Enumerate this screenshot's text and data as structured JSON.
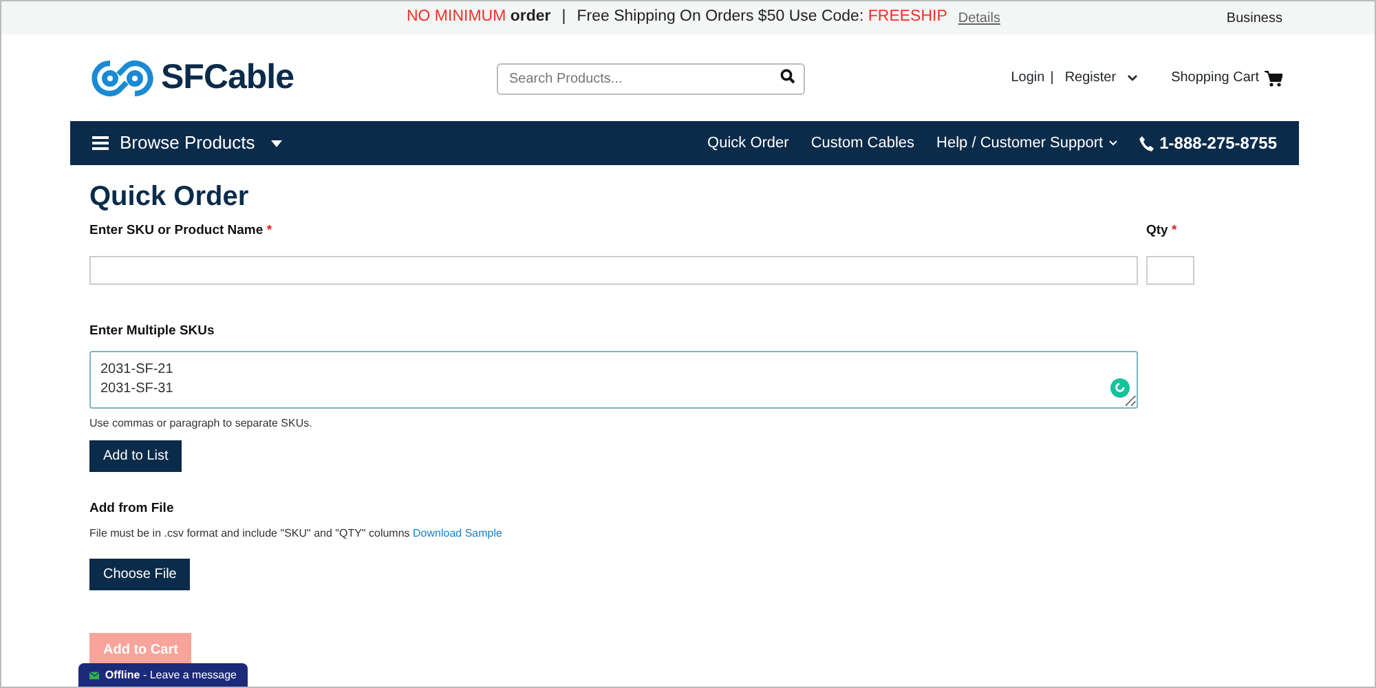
{
  "promo_bar": {
    "highlight": "NO MINIMUM",
    "after_highlight": "order",
    "separator": "|",
    "shipping": "Free Shipping On Orders $50 Use Code:",
    "code": "FREESHIP",
    "details": "Details",
    "business": "Business"
  },
  "header": {
    "logo": "SFCable",
    "search": {
      "placeholder": "Search Products..."
    },
    "login": "Login",
    "separator": "|",
    "register": "Register",
    "cart": "Shopping Cart"
  },
  "nav": {
    "browse": "Browse Products",
    "links": [
      {
        "label": "Quick Order",
        "dropdown": false
      },
      {
        "label": "Custom Cables",
        "dropdown": false
      },
      {
        "label": "Help / Customer Support",
        "dropdown": true
      }
    ],
    "phone": "1-888-275-8755"
  },
  "form": {
    "title": "Quick Order",
    "sku_label": "Enter SKU or Product Name",
    "sku_required": "*",
    "qty_label": "Qty",
    "qty_required": "*",
    "multi_label": "Enter Multiple SKUs",
    "multi_value": "2031-SF-21\n2031-SF-31",
    "multi_help": "Use commas or paragraph to separate SKUs.",
    "add_to_list": "Add to List",
    "file_heading": "Add from File",
    "file_help": "File must be in .csv format and include \"SKU\" and \"QTY\" columns",
    "file_link": "Download Sample",
    "choose_file": "Choose File",
    "add_to_cart": {
      "label": "Add to Cart",
      "disabled": true
    }
  },
  "chat": {
    "status": "Offline",
    "message": "- Leave a message"
  }
}
